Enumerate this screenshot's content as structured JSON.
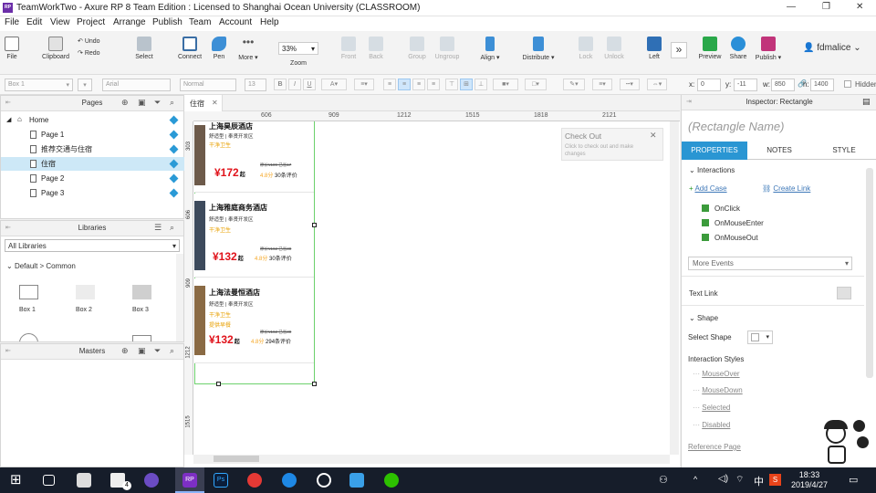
{
  "window": {
    "app_icon": "RP",
    "title": "TeamWorkTwo - Axure RP 8 Team Edition : Licensed to  Shanghai Ocean University (CLASSROOM)",
    "controls": [
      "minimize-icon",
      "restore-icon",
      "close-icon"
    ]
  },
  "menu": [
    "File",
    "Edit",
    "View",
    "Project",
    "Arrange",
    "Publish",
    "Team",
    "Account",
    "Help"
  ],
  "toolbar": {
    "file": "File",
    "clipboard": "Clipboard",
    "undo": "Undo",
    "redo": "Redo",
    "select": "Select",
    "connect": "Connect",
    "pen": "Pen",
    "more": "More ▾",
    "zoom_value": "33%",
    "zoom_label": "Zoom",
    "front": "Front",
    "back": "Back",
    "group": "Group",
    "ungroup": "Ungroup",
    "align": "Align ▾",
    "distribute": "Distribute ▾",
    "lock": "Lock",
    "unlock": "Unlock",
    "left": "Left",
    "preview": "Preview",
    "share": "Share",
    "publish": "Publish ▾",
    "user": "fdmalice"
  },
  "format_bar": {
    "widget_name": "Box 1",
    "font": "Arial",
    "style": "Normal",
    "size": "13",
    "x_label": "x:",
    "x_value": "0",
    "y_label": "y:",
    "y_value": "-11",
    "w_label": "w:",
    "w_value": "850",
    "h_label": "h:",
    "h_value": "1400",
    "hidden": "Hidden"
  },
  "pages": {
    "title": "Pages",
    "items": [
      {
        "label": "Home",
        "level": 0
      },
      {
        "label": "Page 1",
        "level": 1
      },
      {
        "label": "推荐交通与住宿",
        "level": 1
      },
      {
        "label": "住宿",
        "level": 1,
        "active": true
      },
      {
        "label": "Page 2",
        "level": 1
      },
      {
        "label": "Page 3",
        "level": 1
      }
    ]
  },
  "libraries": {
    "title": "Libraries",
    "selected": "All Libraries",
    "group": "Default > Common",
    "items": [
      "Box 1",
      "Box 2",
      "Box 3"
    ]
  },
  "masters": {
    "title": "Masters"
  },
  "canvas": {
    "tab": "住宿",
    "ruler_h": [
      "606",
      "909",
      "1212",
      "1515",
      "1818",
      "2121"
    ],
    "ruler_v": [
      "303",
      "606",
      "909",
      "1212",
      "1515"
    ],
    "checkout": {
      "title": "Check Out",
      "text": "Click to check out and make changes"
    },
    "hotels": [
      {
        "name": "上海昊辰酒店",
        "type": "舒适型 | 奉贤开发区",
        "tag": "干净卫生",
        "old": "原价¥189 已省17",
        "price": "¥172",
        "qi": "起",
        "score": "4.8分",
        "reviews": "30条评价"
      },
      {
        "name": "上海雅庭商务酒店",
        "type": "舒适型 | 奉贤开发区",
        "tag": "干净卫生",
        "old": "原价¥162 已省30",
        "price": "¥132",
        "qi": "起",
        "score": "4.8分",
        "reviews": "30条评价"
      },
      {
        "name": "上海法曼恒酒店",
        "type": "舒适型 | 奉贤开发区",
        "tag": "干净卫生",
        "tag2": "提供早餐",
        "old": "原价¥162 已省30",
        "price": "¥132",
        "qi": "起",
        "score": "4.8分",
        "reviews": "294条评价"
      }
    ]
  },
  "inspector": {
    "title": "Inspector: Rectangle",
    "name_placeholder": "(Rectangle Name)",
    "tabs": [
      "PROPERTIES",
      "NOTES",
      "STYLE"
    ],
    "interactions": "Interactions",
    "add_case": "Add Case",
    "create_link": "Create Link",
    "events": [
      "OnClick",
      "OnMouseEnter",
      "OnMouseOut"
    ],
    "more_events": "More Events",
    "text_link": "Text Link",
    "shape": "Shape",
    "select_shape": "Select Shape",
    "interaction_styles": "Interaction Styles",
    "styles": [
      "MouseOver",
      "MouseDown",
      "Selected",
      "Disabled"
    ],
    "reference_page": "Reference Page"
  },
  "taskbar": {
    "time": "18:33",
    "date": "2019/4/27",
    "ime": "中",
    "mail_badge": "4"
  }
}
